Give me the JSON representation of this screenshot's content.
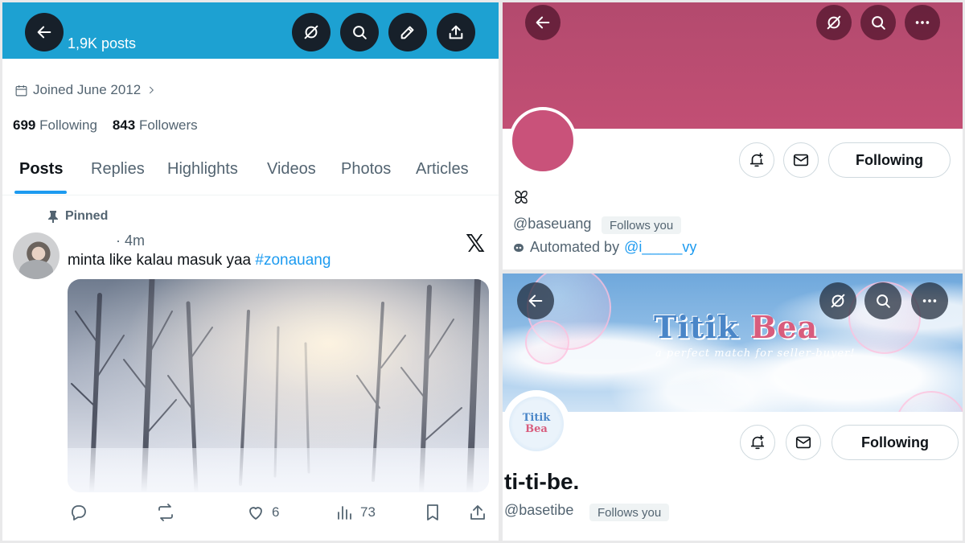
{
  "left": {
    "post_count": "1,9K posts",
    "joined": "Joined June 2012",
    "following_count": "699",
    "following_label": "Following",
    "followers_count": "843",
    "followers_label": "Followers",
    "tabs": [
      "Posts",
      "Replies",
      "Highlights",
      "Videos",
      "Photos",
      "Articles"
    ],
    "active_tab": "Posts",
    "pinned_label": "Pinned",
    "post": {
      "time": "· 4m",
      "text": "minta like kalau masuk yaa ",
      "hashtag": "#zonauang",
      "likes": "6",
      "views": "73"
    },
    "icons": [
      "back-icon",
      "grok-icon",
      "search-icon",
      "edit-icon",
      "share-icon",
      "calendar-icon",
      "chevron-right-icon",
      "pin-icon",
      "x-logo-icon",
      "reply-icon",
      "repost-icon",
      "like-icon",
      "views-icon",
      "bookmark-icon",
      "share-icon"
    ],
    "x_logo": "𝕏"
  },
  "right_top": {
    "name": "ꕤ",
    "handle": "@baseuang",
    "follows_you": "Follows you",
    "automated_prefix": "Automated by ",
    "automated_link": "@i_____vy",
    "following_button": "Following",
    "banner_color": "#c24f74",
    "icons": [
      "back-icon",
      "grok-icon",
      "search-icon",
      "more-icon",
      "notification-add-icon",
      "message-icon",
      "bot-icon"
    ]
  },
  "right_bottom": {
    "banner_title_part1": "Titik ",
    "banner_title_part2": "Bea",
    "banner_subtitle": "a perfect match for seller-buyer!",
    "avatar_text_1": "Titik",
    "avatar_text_2": "Bea",
    "name": "ti-ti-be.",
    "handle": "@basetibe",
    "follows_you": "Follows you",
    "following_button": "Following",
    "icons": [
      "back-icon",
      "grok-icon",
      "search-icon",
      "more-icon",
      "notification-add-icon",
      "message-icon"
    ]
  },
  "colors": {
    "accent": "#1d9bf0",
    "left_banner": "#1da1d2",
    "text_secondary": "#536471"
  }
}
